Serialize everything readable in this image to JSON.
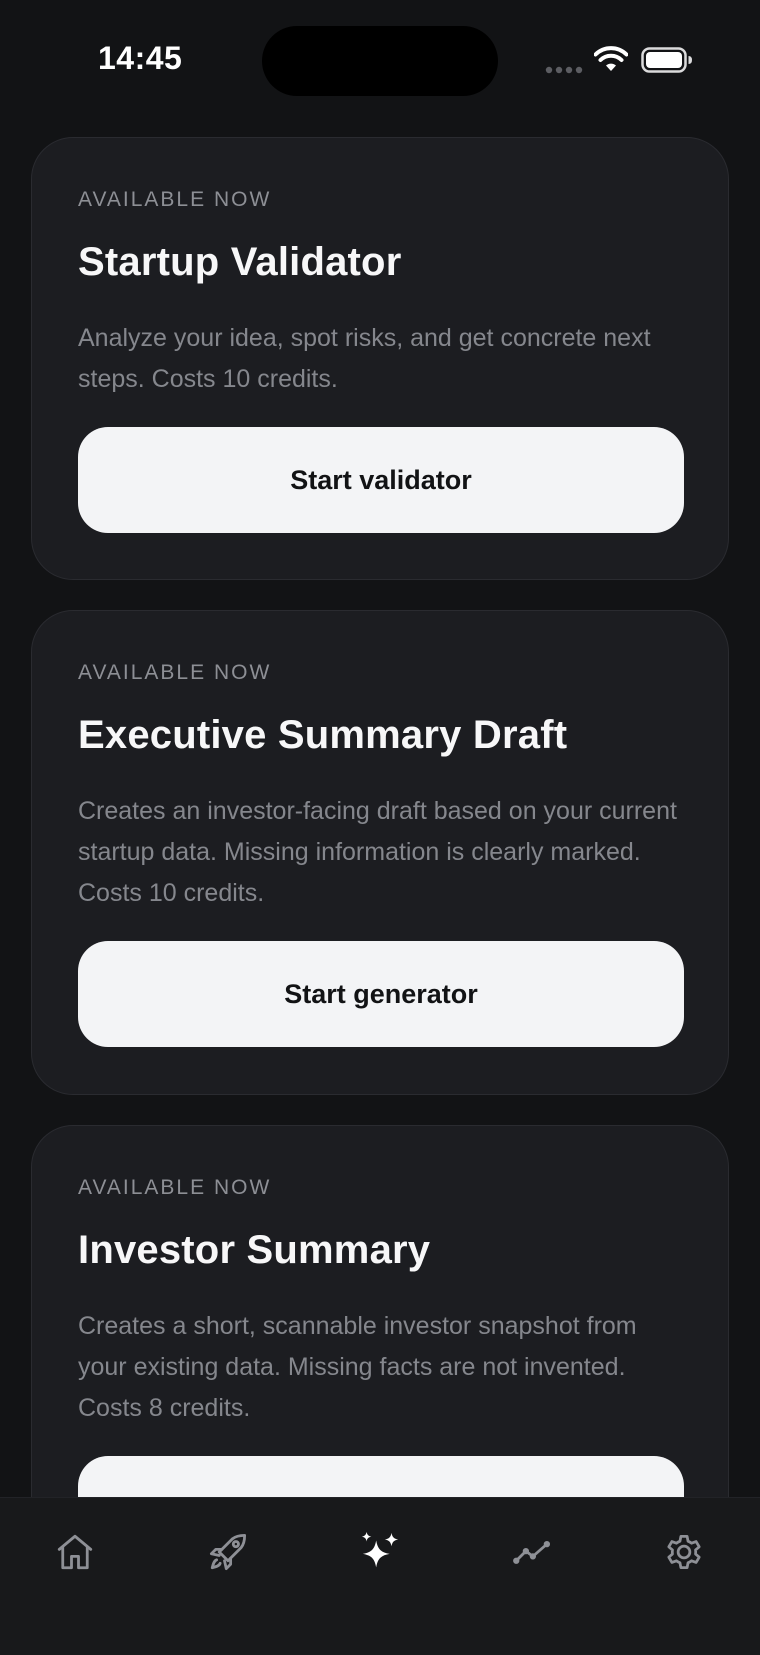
{
  "status_bar": {
    "time": "14:45"
  },
  "cards": [
    {
      "eyebrow": "AVAILABLE NOW",
      "title": "Startup Validator",
      "description": "Analyze your idea, spot risks, and get concrete next steps. Costs 10 credits.",
      "button_label": "Start validator"
    },
    {
      "eyebrow": "AVAILABLE NOW",
      "title": "Executive Summary Draft",
      "description": "Creates an investor-facing draft based on your current startup data. Missing information is clearly marked. Costs 10 credits.",
      "button_label": "Start generator"
    },
    {
      "eyebrow": "AVAILABLE NOW",
      "title": "Investor Summary",
      "description": "Creates a short, scannable investor snapshot from your existing data. Missing facts are not invented. Costs 8 credits.",
      "button_label": ""
    }
  ],
  "tab_bar": {
    "items": [
      {
        "icon": "home-icon",
        "active": false
      },
      {
        "icon": "rocket-icon",
        "active": false
      },
      {
        "icon": "sparkles-icon",
        "active": true
      },
      {
        "icon": "chart-line-icon",
        "active": false
      },
      {
        "icon": "gear-icon",
        "active": false
      }
    ]
  },
  "colors": {
    "background": "#121315",
    "card": "#1c1d21",
    "button": "#f3f4f6",
    "muted_text": "#85878d",
    "active_icon": "#ffffff",
    "inactive_icon": "#8e9096"
  }
}
